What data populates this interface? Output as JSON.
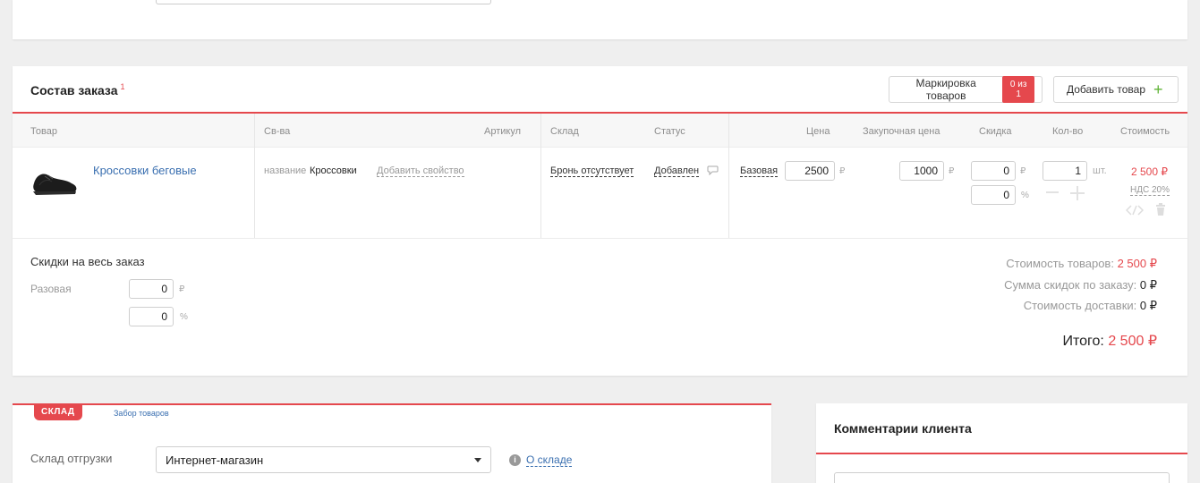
{
  "order": {
    "title": "Состав заказа",
    "title_sup": "1",
    "marking_button": "Маркировка товаров",
    "marking_badge": "0 из 1",
    "add_product_button": "Добавить товар",
    "columns": {
      "product": "Товар",
      "properties": "Св-ва",
      "article": "Артикул",
      "warehouse": "Склад",
      "status": "Статус",
      "price": "Цена",
      "purchase_price": "Закупочная цена",
      "discount": "Скидка",
      "quantity": "Кол-во",
      "cost": "Стоимость"
    },
    "item": {
      "name": "Кроссовки беговые",
      "property_key": "название",
      "property_value": "Кроссовки",
      "add_property": "Добавить свойство",
      "reserve": "Бронь отсутствует",
      "status": "Добавлен",
      "price_type": "Базовая",
      "price": "2500",
      "price_unit": "₽",
      "purchase_price": "1000",
      "purchase_unit": "₽",
      "discount_rub": "0",
      "discount_rub_unit": "₽",
      "discount_pct": "0",
      "discount_pct_unit": "%",
      "quantity": "1",
      "quantity_unit": "шт.",
      "cost": "2 500 ₽",
      "vat": "НДС 20%"
    },
    "discounts": {
      "title": "Скидки на весь заказ",
      "one_time_label": "Разовая",
      "rub_value": "0",
      "rub_unit": "₽",
      "pct_value": "0",
      "pct_unit": "%"
    },
    "summary": {
      "goods_label": "Стоимость товаров:",
      "goods_value": "2 500 ₽",
      "discount_label": "Сумма скидок по заказу:",
      "discount_value": "0 ₽",
      "delivery_label": "Стоимость доставки:",
      "delivery_value": "0 ₽",
      "total_label": "Итого:",
      "total_value": "2 500 ₽"
    }
  },
  "warehouse": {
    "tag": "СКЛАД",
    "pickup_link": "Забор товаров",
    "ship_label": "Склад отгрузки",
    "ship_value": "Интернет-магазин",
    "about_link": "О складе"
  },
  "comments": {
    "title": "Комментарии клиента"
  },
  "colors": {
    "accent": "#e5484d",
    "link": "#3a6fb0",
    "add_plus": "#5fb336"
  }
}
